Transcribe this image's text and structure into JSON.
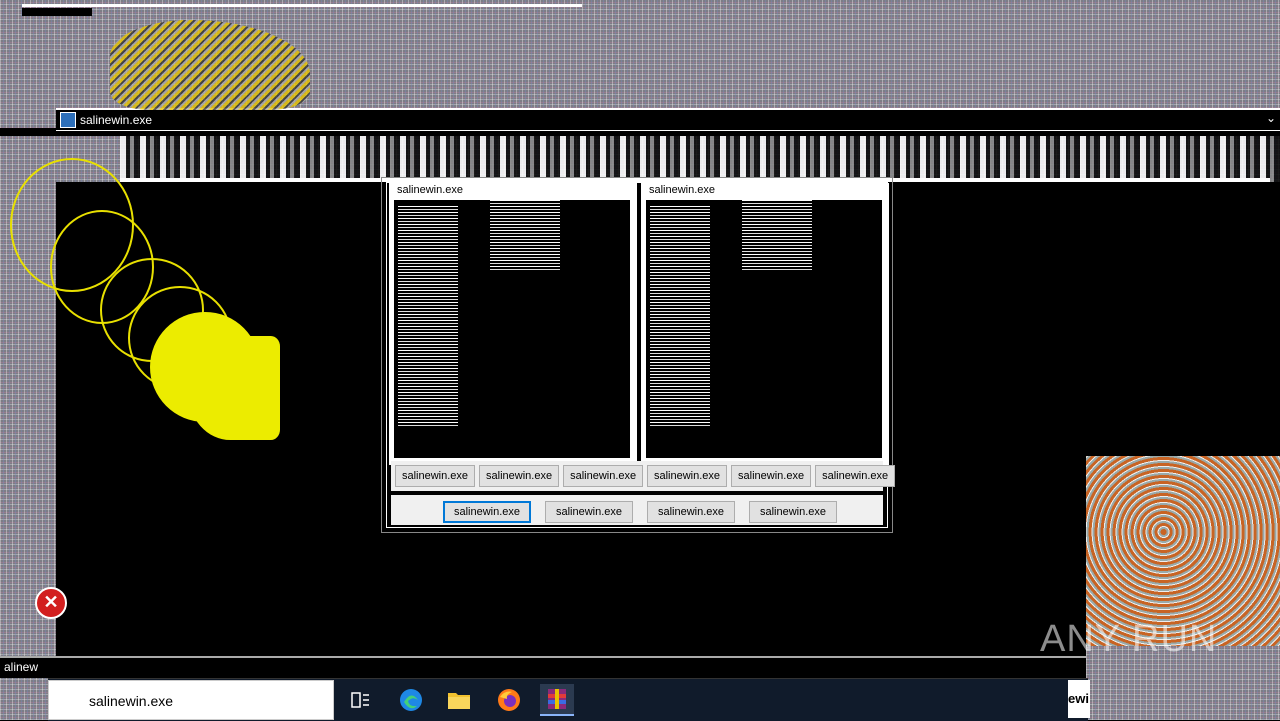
{
  "main_window": {
    "title": "salinewin.exe"
  },
  "dialogs": [
    {
      "title": "salinewin.exe",
      "buttons": [
        "salinewin.exe",
        "salinewin.exe",
        "salinewin.exe"
      ]
    },
    {
      "title": "salinewin.exe",
      "buttons": [
        "salinewin.exe",
        "salinewin.exe",
        "salinewin.exe"
      ]
    }
  ],
  "bottom_buttons": [
    "salinewin.exe",
    "salinewin.exe",
    "salinewin.exe",
    "salinewin.exe"
  ],
  "status_label": "alinew",
  "taskbar": {
    "search_value": "salinewin.exe",
    "apps": [
      "task-view-icon",
      "edge-icon",
      "file-explorer-icon",
      "firefox-icon",
      "winrar-icon"
    ],
    "tray_stub": "ewi"
  },
  "watermark": "ANY RUN",
  "colors": {
    "yellow": "#ecec00",
    "orange": "#c86424",
    "accent": "#0078d7"
  }
}
